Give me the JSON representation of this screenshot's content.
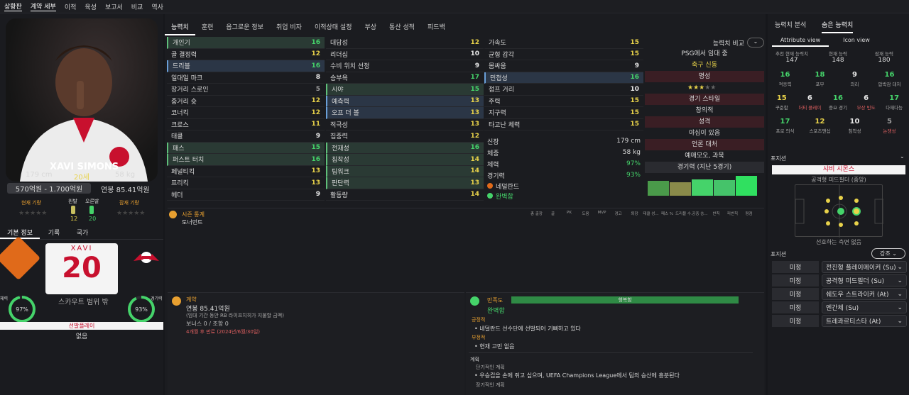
{
  "topnav": {
    "items": [
      "상황판",
      "계약 세부",
      "이적",
      "육성",
      "보고서",
      "비교",
      "역사"
    ]
  },
  "player": {
    "name_on_photo": "XAVI SIMONS",
    "height": "179 cm",
    "age": "20세",
    "weight": "58 kg",
    "value": "570억원 - 1.700억원",
    "wage": "연봉 85.41억원",
    "current_rating_label": "현재 기량",
    "potential_rating_label": "잠재 기량",
    "left_foot_label": "왼발",
    "right_foot_label": "오른발",
    "left_foot": "12",
    "right_foot": "20"
  },
  "left_tabs": [
    "기본 정보",
    "기록",
    "국가"
  ],
  "shirt": {
    "name": "XAVI",
    "number": "20"
  },
  "scout_range": "스카우트 범위 밖",
  "fitness": {
    "label": "체력",
    "value": "97%"
  },
  "match_fitness": {
    "label": "경기력",
    "value": "93%"
  },
  "role_bar": "선발플레이",
  "role_sub": "없음",
  "center_tabs": [
    "능력치",
    "훈련",
    "옵그로운 정보",
    "취업 비자",
    "이적상태 설정",
    "부상",
    "통산 성적",
    "피드백"
  ],
  "technical": [
    {
      "n": "개인기",
      "v": "16",
      "c": "g",
      "h": "hl"
    },
    {
      "n": "골 결정력",
      "v": "12",
      "c": "y",
      "h": ""
    },
    {
      "n": "드리블",
      "v": "16",
      "c": "g",
      "h": "hl2"
    },
    {
      "n": "일대일 마크",
      "v": "8",
      "c": "w",
      "h": ""
    },
    {
      "n": "장거리 스로인",
      "v": "5",
      "c": "gr",
      "h": ""
    },
    {
      "n": "중거리 슛",
      "v": "12",
      "c": "y",
      "h": ""
    },
    {
      "n": "코너킥",
      "v": "12",
      "c": "y",
      "h": ""
    },
    {
      "n": "크로스",
      "v": "11",
      "c": "y",
      "h": ""
    },
    {
      "n": "태클",
      "v": "9",
      "c": "w",
      "h": ""
    },
    {
      "n": "패스",
      "v": "15",
      "c": "g",
      "h": "hl"
    },
    {
      "n": "퍼스트 터치",
      "v": "16",
      "c": "g",
      "h": "hl"
    },
    {
      "n": "페널티킥",
      "v": "13",
      "c": "y",
      "h": ""
    },
    {
      "n": "프리킥",
      "v": "13",
      "c": "y",
      "h": ""
    },
    {
      "n": "헤더",
      "v": "9",
      "c": "w",
      "h": ""
    }
  ],
  "mental": [
    {
      "n": "대담성",
      "v": "12",
      "c": "y",
      "h": ""
    },
    {
      "n": "리더십",
      "v": "10",
      "c": "w",
      "h": ""
    },
    {
      "n": "수비 위치 선정",
      "v": "9",
      "c": "w",
      "h": ""
    },
    {
      "n": "승부욕",
      "v": "17",
      "c": "g",
      "h": ""
    },
    {
      "n": "시야",
      "v": "15",
      "c": "g",
      "h": "hl"
    },
    {
      "n": "예측력",
      "v": "13",
      "c": "y",
      "h": "hl2"
    },
    {
      "n": "오프 더 볼",
      "v": "13",
      "c": "y",
      "h": "hl2"
    },
    {
      "n": "적극성",
      "v": "13",
      "c": "y",
      "h": ""
    },
    {
      "n": "집중력",
      "v": "12",
      "c": "y",
      "h": ""
    },
    {
      "n": "전재성",
      "v": "16",
      "c": "g",
      "h": "hl"
    },
    {
      "n": "침착성",
      "v": "14",
      "c": "y",
      "h": "hl"
    },
    {
      "n": "팀워크",
      "v": "14",
      "c": "y",
      "h": "hl"
    },
    {
      "n": "판단력",
      "v": "13",
      "c": "y",
      "h": "hl"
    },
    {
      "n": "활동량",
      "v": "14",
      "c": "y",
      "h": ""
    }
  ],
  "physical": [
    {
      "n": "가속도",
      "v": "15",
      "c": "y",
      "h": ""
    },
    {
      "n": "균형 감각",
      "v": "15",
      "c": "y",
      "h": ""
    },
    {
      "n": "몸싸움",
      "v": "9",
      "c": "w",
      "h": ""
    },
    {
      "n": "민첩성",
      "v": "16",
      "c": "g",
      "h": "hl2"
    },
    {
      "n": "점프 거리",
      "v": "10",
      "c": "w",
      "h": ""
    },
    {
      "n": "주력",
      "v": "15",
      "c": "y",
      "h": ""
    },
    {
      "n": "지구력",
      "v": "15",
      "c": "y",
      "h": ""
    },
    {
      "n": "타고난 체력",
      "v": "15",
      "c": "y",
      "h": ""
    }
  ],
  "info": {
    "height_label": "신장",
    "height": "179 cm",
    "weight_label": "체중",
    "weight": "58 kg",
    "fitness_label": "체력",
    "fitness": "97%",
    "match_label": "경기력",
    "match": "93%",
    "nation": "네덜란드",
    "fit": "완벽함"
  },
  "compare": {
    "label": "능력치 비교",
    "loan": "PSG에서 임대 중",
    "club": "축구 신동",
    "rep_label": "명성",
    "style_label": "경기 스타일",
    "style": "창의적",
    "personality_label": "성격",
    "personality": "야심이 있음",
    "media_label": "언론 대처",
    "media": "예매모오, 과묵",
    "form_label": "경기력 (지난 5경기)",
    "form": [
      0.42,
      0.38,
      0.45,
      0.43,
      0.55
    ]
  },
  "season": {
    "label": "시즌 통계",
    "sub": "토너먼트",
    "cols": [
      "총 출장",
      "골",
      "PK",
      "도움",
      "MVP",
      "경고",
      "퇴장",
      "태클 성...",
      "패스 %",
      "드리블 수...",
      "공중 승...",
      "반칙",
      "피반칙",
      "평점"
    ]
  },
  "contract": {
    "label": "계약",
    "wage": "연봉 85.41억원",
    "note": "(임대 기간 동안 RB 라이프치히가 지불할 금액)",
    "bonus": "보너스 0 / 조항 0",
    "end": "4개월 후 만료 (2024년/6월/30일)"
  },
  "happiness": {
    "label": "만족도",
    "bar": "행복함",
    "status": "완벽함",
    "pos_label": "긍정적",
    "pos": "네덜란드 선수단에 선발되어 기뻐하고 있다",
    "neg_label": "부정적",
    "neg": "현재 고민 없음",
    "plan_label": "계획",
    "short_label": "단기적인 계획",
    "short": "우승컵을 손에 쥐고 싶으며, UEFA Champions League에서 팀의 승산에 흥분된다",
    "long_label": "장기적인 계획"
  },
  "right_panel": {
    "tabs": [
      "능력치 분석",
      "숨은 능력치"
    ],
    "views": [
      "Attribute view",
      "Icon view"
    ],
    "hdr": [
      "추천 현재 능력치",
      "현재 능력",
      "잠재 능력"
    ],
    "hdr_vals": [
      "147",
      "148",
      "180"
    ],
    "stats": [
      {
        "n": "16",
        "t": "적응력",
        "c": "g"
      },
      {
        "n": "18",
        "t": "포부",
        "c": "g"
      },
      {
        "n": "9",
        "t": "의리",
        "c": "w"
      },
      {
        "n": "16",
        "t": "압박감 대처",
        "c": "g"
      },
      {
        "n": "15",
        "t": "꾸준함",
        "c": "y"
      },
      {
        "n": "6",
        "t": "더티 플레이",
        "c": "w"
      },
      {
        "n": "16",
        "t": "중요 경기",
        "c": "g"
      },
      {
        "n": "6",
        "t": "부상 빈도",
        "c": "w"
      },
      {
        "n": "17",
        "t": "다재다능",
        "c": "g"
      },
      {
        "n": "17",
        "t": "프로 의식",
        "c": "g"
      },
      {
        "n": "12",
        "t": "스포츠맨십",
        "c": "y"
      },
      {
        "n": "10",
        "t": "침착성",
        "c": "w"
      },
      {
        "n": "5",
        "t": "논쟁성",
        "c": "gr"
      }
    ],
    "pos_label": "포지션",
    "pos_name": "샤비 시몬스",
    "pos_role": "공격형 미드필더 (중앙)",
    "pos_sub": "선호하는 측면 없음",
    "roles_label": "포지션",
    "emph": "강조",
    "roles": [
      {
        "l": "미정",
        "r": "전진형 플레이메이커 (Su)"
      },
      {
        "l": "미정",
        "r": "공격형 미드필더 (Su)"
      },
      {
        "l": "미정",
        "r": "쉐도우 스트라이커 (At)"
      },
      {
        "l": "미정",
        "r": "엔간체 (Su)"
      },
      {
        "l": "미정",
        "r": "트레콰르티스타 (At)"
      }
    ]
  }
}
